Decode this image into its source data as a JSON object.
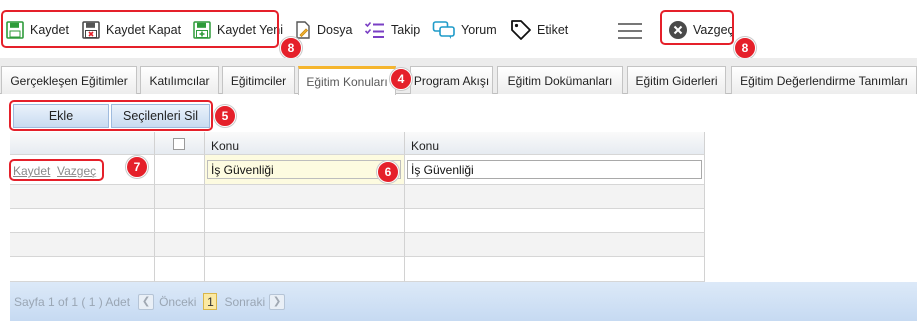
{
  "toolbar": {
    "save": "Kaydet",
    "save_close": "Kaydet Kapat",
    "save_new": "Kaydet Yeni",
    "file": "Dosya",
    "follow": "Takip",
    "comment": "Yorum",
    "tag": "Etiket",
    "cancel": "Vazgeç"
  },
  "tabs": [
    "Gerçekleşen Eğitimler",
    "Katılımcılar",
    "Eğitimciler",
    "Eğitim Konuları",
    "Program Akışı",
    "Eğitim Dokümanları",
    "Eğitim Giderleri",
    "Eğitim Değerlendirme Tanımları"
  ],
  "active_tab": "Eğitim Konuları",
  "actions": {
    "add": "Ekle",
    "delete_selected": "Seçilenleri Sil"
  },
  "grid": {
    "columns": [
      "",
      "",
      "Konu",
      "Konu"
    ],
    "edit_row": {
      "save_link": "Kaydet",
      "cancel_link": "Vazgeç",
      "konu_input": "İş Güvenliği",
      "konu_value": "İş Güvenliği"
    },
    "pager": {
      "info": "Sayfa 1 of 1 ( 1 ) Adet",
      "prev": "Önceki",
      "page": "1",
      "next": "Sonraki"
    }
  },
  "annotations": {
    "badge_4": "4",
    "badge_5": "5",
    "badge_6": "6",
    "badge_7": "7",
    "badge_8a": "8",
    "badge_8b": "8"
  },
  "colors": {
    "annotation_red": "#e5202a",
    "active_tab_accent": "#f5b52e",
    "pager_blue": "#c6daf2",
    "edit_cell_yellow": "#fdfbe0"
  }
}
